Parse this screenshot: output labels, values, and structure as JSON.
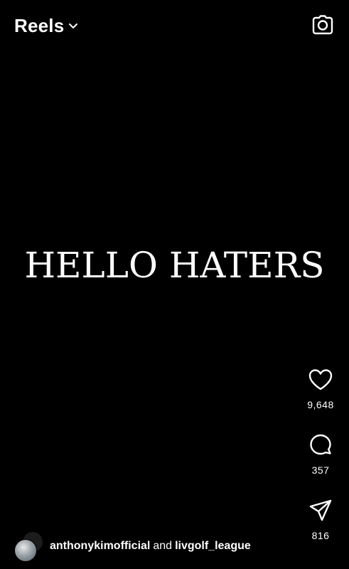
{
  "header": {
    "title": "Reels",
    "dropdown_icon": "chevron-down-icon",
    "camera_icon": "camera-icon"
  },
  "video": {
    "overlay_text": "HELLO HATERS"
  },
  "actions": {
    "like": {
      "icon": "heart-icon",
      "count": "9,648"
    },
    "comment": {
      "icon": "comment-icon",
      "count": "357"
    },
    "share": {
      "icon": "send-icon",
      "count": "816"
    }
  },
  "footer": {
    "user1": "anthonykimofficial",
    "conjunction": "and",
    "user2": "livgolf_league"
  },
  "colors": {
    "background": "#000000",
    "foreground": "#ffffff"
  }
}
